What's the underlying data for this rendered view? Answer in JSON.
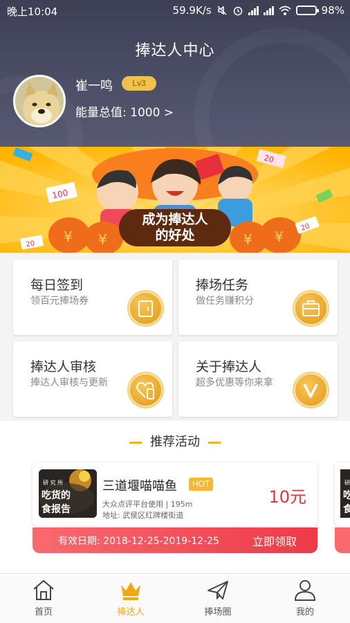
{
  "status_bar": {
    "time": "晚上10:04",
    "network_speed": "59.9K/s",
    "battery": "98%"
  },
  "header": {
    "title": "捧达人中心",
    "user": {
      "name": "崔一鸣",
      "level": "Lv3",
      "energy_label": "能量总值:",
      "energy_value": "1000 >"
    }
  },
  "banner": {
    "caption_line1": "成为捧达人",
    "caption_line2": "的好处",
    "tag_100": "100",
    "tag_20a": "20",
    "tag_20b": "20",
    "tag_20c": "20",
    "yen": "¥"
  },
  "cards": [
    {
      "title": "每日签到",
      "subtitle": "领百元捧场券",
      "icon": "wallet-icon"
    },
    {
      "title": "捧场任务",
      "subtitle": "做任务赚积分",
      "icon": "briefcase-icon"
    },
    {
      "title": "捧达人审核",
      "subtitle": "捧达人审核与更新",
      "icon": "heart-phone-icon"
    },
    {
      "title": "关于捧达人",
      "subtitle": "超多优惠等你来拿",
      "icon": "v-icon"
    }
  ],
  "recommended": {
    "section_title": "推荐活动",
    "promo": {
      "image_text_small": "研 究 所",
      "image_text_line1": "吃货的",
      "image_text_line2": "食报告",
      "name": "三道堰喵喵鱼",
      "badge": "HOT",
      "meta_line1": "大众点评平台使用 | 195m",
      "meta_line2": "地址: 武侯区红牌楼街道",
      "price": "10元",
      "validity": "有效日期: 2018-12-25-2019-12-25",
      "claim_label": "立即领取"
    },
    "peek": {
      "image_text_small": "研",
      "image_text_line1": "吃",
      "image_text_line2": "食"
    }
  },
  "tabbar": {
    "items": [
      {
        "label": "首页",
        "icon": "home-icon"
      },
      {
        "label": "捧达人",
        "icon": "crown-icon",
        "active": true
      },
      {
        "label": "捧场圈",
        "icon": "paper-plane-icon"
      },
      {
        "label": "我的",
        "icon": "person-icon"
      }
    ]
  },
  "colors": {
    "header_bg": "#4b4e66",
    "accent_gold": "#f0a818",
    "price_red": "#e8303b",
    "banner_yellow": "#ffc21d"
  }
}
